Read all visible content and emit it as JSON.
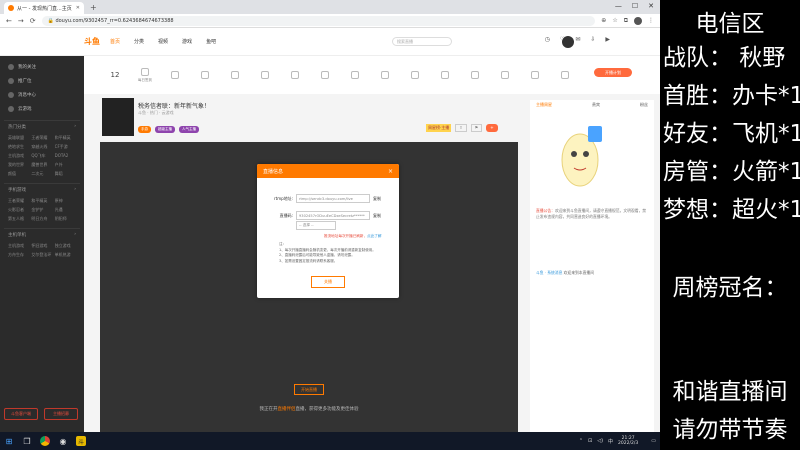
{
  "browser": {
    "tab_title": "从一 - 发现热门直...主页",
    "url": "douyu.com/9302457_rr=0.6243684674673388",
    "new_tab": "+"
  },
  "site": {
    "logo": "斗鱼",
    "nav": [
      "首页",
      "分类",
      "视频",
      "游戏",
      "鱼吧"
    ],
    "search_placeholder": "搜索直播",
    "hot_button": "开播计划",
    "categories": [
      "12",
      "每日签到",
      "",
      "",
      "",
      "",
      "",
      "",
      "",
      "",
      "",
      "",
      "",
      "",
      "",
      "",
      "",
      ""
    ],
    "level_label": "12"
  },
  "sidebar": {
    "items": [
      "我的关注",
      "推广位",
      "消息中心",
      "云游戏"
    ],
    "section1": "热门分类",
    "grid1": [
      "英雄联盟",
      "王者荣耀",
      "和平精英",
      "绝地求生",
      "穿越火线",
      "CF手游",
      "主机游戏",
      "QQ飞车",
      "DOTA2",
      "我的世界",
      "魔兽世界",
      "户外",
      "颜值",
      "二次元",
      "舞蹈"
    ],
    "section2": "手机游戏",
    "grid2": [
      "王者荣耀",
      "和平精英",
      "原神",
      "火影忍者",
      "金铲铲",
      "光遇",
      "第五人格",
      "明日方舟",
      "阴阳师"
    ],
    "section3": "主机单机",
    "grid3": [
      "主机游戏",
      "怀旧游戏",
      "独立游戏",
      "方舟生存",
      "艾尔登法环",
      "单机热游"
    ],
    "btn1": "斗鱼客户端",
    "btn2": "主播招募"
  },
  "room": {
    "title": "税务信者联：新年新气象！",
    "meta": "斗鱼 · 热门 · 云游戏",
    "tags": [
      "手游",
      "超级主播",
      "人气主播"
    ],
    "right_badge": "周星榜·主播",
    "open_text": "开始直播",
    "caption_prefix": "我正在开",
    "caption_link": "直播伴侣",
    "caption_suffix": "直播，获得更多功能及更佳体验"
  },
  "chat": {
    "tabs": [
      "主播周星",
      "贵宾",
      "粉丝"
    ],
    "notice_label": "直播公告：",
    "notice": "欢迎来到斗鱼直播间，请遵守直播规范，文明观看，禁止发布违规内容，共同营造良好的直播环境。",
    "row_user": "斗鱼 · 系统消息",
    "row_text": "欢迎来到本直播间"
  },
  "modal": {
    "title": "直播信息",
    "close": "×",
    "rtmp_label": "rtmp地址:",
    "rtmp_value": "rtmp://sendc3.douyu.com/live",
    "key_label": "直播码:",
    "key_value": "9302457rODuuEeCDxeSecretz******",
    "copy": "复制",
    "select_value": "-- 选择 --",
    "warning": "推流地址每次开播已刷新，",
    "warning_link": "点此了解",
    "tips": [
      "注：",
      "1、每次开播直播码会随机变更，每次开播前请重新复制使用。",
      "2、直播码泄露后可能导致他人盗播，请勿泄露。",
      "3、如需设置固定推流码请联系客服。"
    ],
    "confirm": "关播"
  },
  "taskbar": {
    "time": "21:27",
    "date": "2022/2/3"
  },
  "overlay": {
    "title": "电信区",
    "lines": [
      "战队：  秋野",
      "首胜：办卡*1",
      "好友：飞机*1",
      "房管：火箭*1",
      "梦想：超火*1"
    ],
    "weekly_label": "周榜冠名：",
    "footer": [
      "和谐直播间",
      "请勿带节奏"
    ]
  }
}
